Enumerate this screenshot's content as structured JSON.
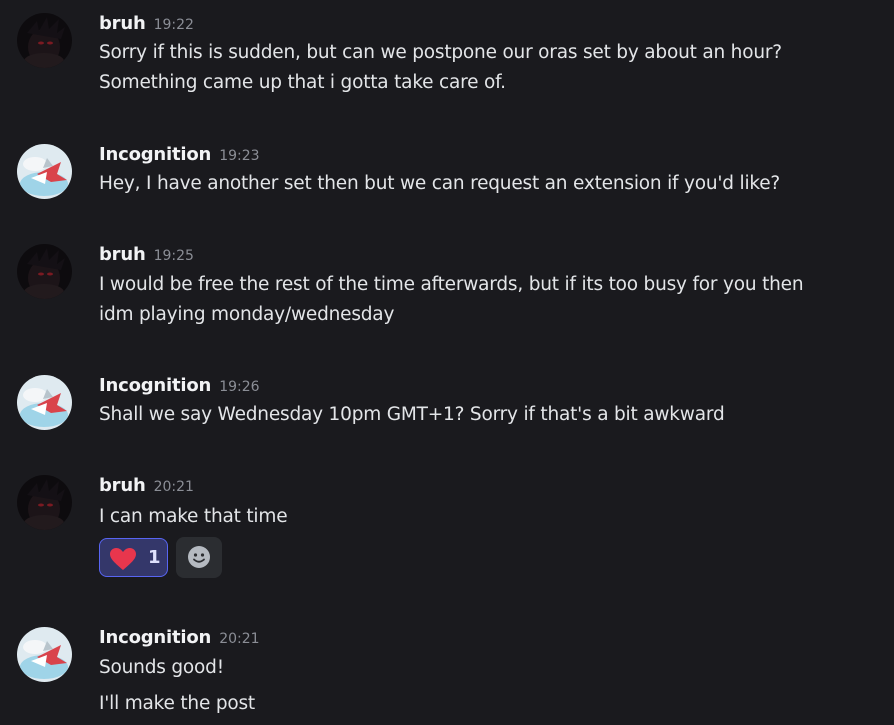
{
  "messages": [
    {
      "author": "bruh",
      "time": "19:22",
      "lines": [
        "Sorry if this is sudden, but can we postpone our oras set by about an hour?",
        "Something came up that i gotta take care of."
      ]
    },
    {
      "author": "Incognition",
      "time": "19:23",
      "lines": [
        "Hey, I have another set then but we can request an extension if you'd like?"
      ]
    },
    {
      "author": "bruh",
      "time": "19:25",
      "lines": [
        "I would be free the rest of the time afterwards, but if its too busy for you then",
        "idm playing monday/wednesday"
      ]
    },
    {
      "author": "Incognition",
      "time": "19:26",
      "lines": [
        "Shall we say Wednesday 10pm GMT+1? Sorry if that's a bit awkward"
      ]
    },
    {
      "author": "bruh",
      "time": "20:21",
      "lines": [
        "I can make that time"
      ],
      "reaction": {
        "emoji": "heart-icon",
        "count": "1"
      },
      "add_reaction_icon": "add-reaction-smiley-icon"
    },
    {
      "author": "Incognition",
      "time": "20:21",
      "lines": [
        "Sounds good!",
        "I'll make the post"
      ]
    }
  ],
  "colors": {
    "background": "#1a1a1e",
    "text": "#e3e5e8",
    "author": "#f2f3f5",
    "timestamp": "#8b8e96",
    "reaction_active_bg": "#34376a",
    "reaction_active_border": "#5865f2",
    "heart": "#e8364d"
  }
}
